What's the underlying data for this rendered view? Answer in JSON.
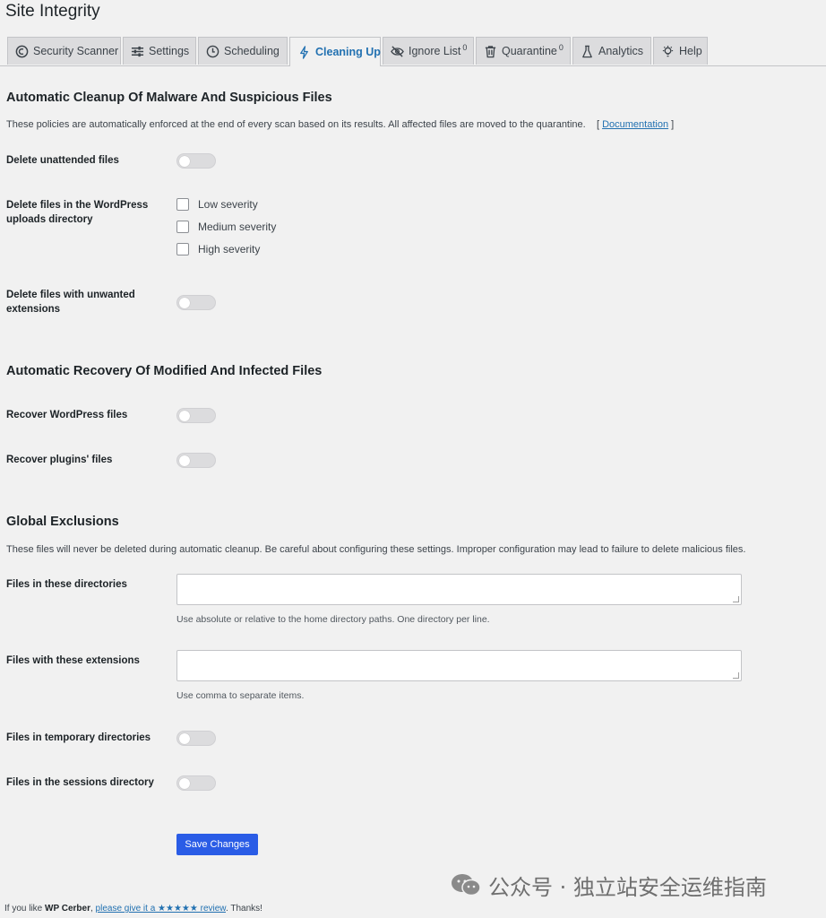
{
  "page": {
    "title": "Site Integrity"
  },
  "tabs": [
    {
      "label": "Security Scanner",
      "icon": "shield-icon"
    },
    {
      "label": "Settings",
      "icon": "sliders-icon"
    },
    {
      "label": "Scheduling",
      "icon": "clock-icon"
    },
    {
      "label": "Cleaning Up",
      "icon": "bolt-icon",
      "active": true
    },
    {
      "label": "Ignore List",
      "icon": "eye-off-icon",
      "badge": "0"
    },
    {
      "label": "Quarantine",
      "icon": "trash-icon",
      "badge": "0"
    },
    {
      "label": "Analytics",
      "icon": "flask-icon"
    },
    {
      "label": "Help",
      "icon": "lightbulb-icon"
    }
  ],
  "cleanup": {
    "heading": "Automatic Cleanup Of Malware And Suspicious Files",
    "description": "These policies are automatically enforced at the end of every scan based on its results. All affected files are moved to the quarantine.",
    "doc_open": "[",
    "doc_link": "Documentation",
    "doc_close": "]",
    "delete_unattended": {
      "label": "Delete unattended files",
      "on": false
    },
    "delete_uploads": {
      "label": "Delete files in the WordPress uploads directory",
      "options": [
        {
          "label": "Low severity",
          "checked": false
        },
        {
          "label": "Medium severity",
          "checked": false
        },
        {
          "label": "High severity",
          "checked": false
        }
      ]
    },
    "delete_unwanted_ext": {
      "label": "Delete files with unwanted extensions",
      "on": false
    }
  },
  "recovery": {
    "heading": "Automatic Recovery Of Modified And Infected Files",
    "recover_wp": {
      "label": "Recover WordPress files",
      "on": false
    },
    "recover_plugins": {
      "label": "Recover plugins' files",
      "on": false
    }
  },
  "exclusions": {
    "heading": "Global Exclusions",
    "description": "These files will never be deleted during automatic cleanup. Be careful about configuring these settings. Improper configuration may lead to failure to delete malicious files.",
    "dirs": {
      "label": "Files in these directories",
      "value": "",
      "hint": "Use absolute or relative to the home directory paths. One directory per line."
    },
    "exts": {
      "label": "Files with these extensions",
      "value": "",
      "hint": "Use comma to separate items."
    },
    "temp_dirs": {
      "label": "Files in temporary directories",
      "on": false
    },
    "sessions_dir": {
      "label": "Files in the sessions directory",
      "on": false
    }
  },
  "save_label": "Save Changes",
  "footer": {
    "prefix": "If you like ",
    "brand": "WP Cerber",
    "sep": ", ",
    "link": "please give it a ★★★★★ review",
    "suffix": ". Thanks!"
  },
  "watermark": {
    "text": "公众号 · 独立站安全运维指南"
  }
}
